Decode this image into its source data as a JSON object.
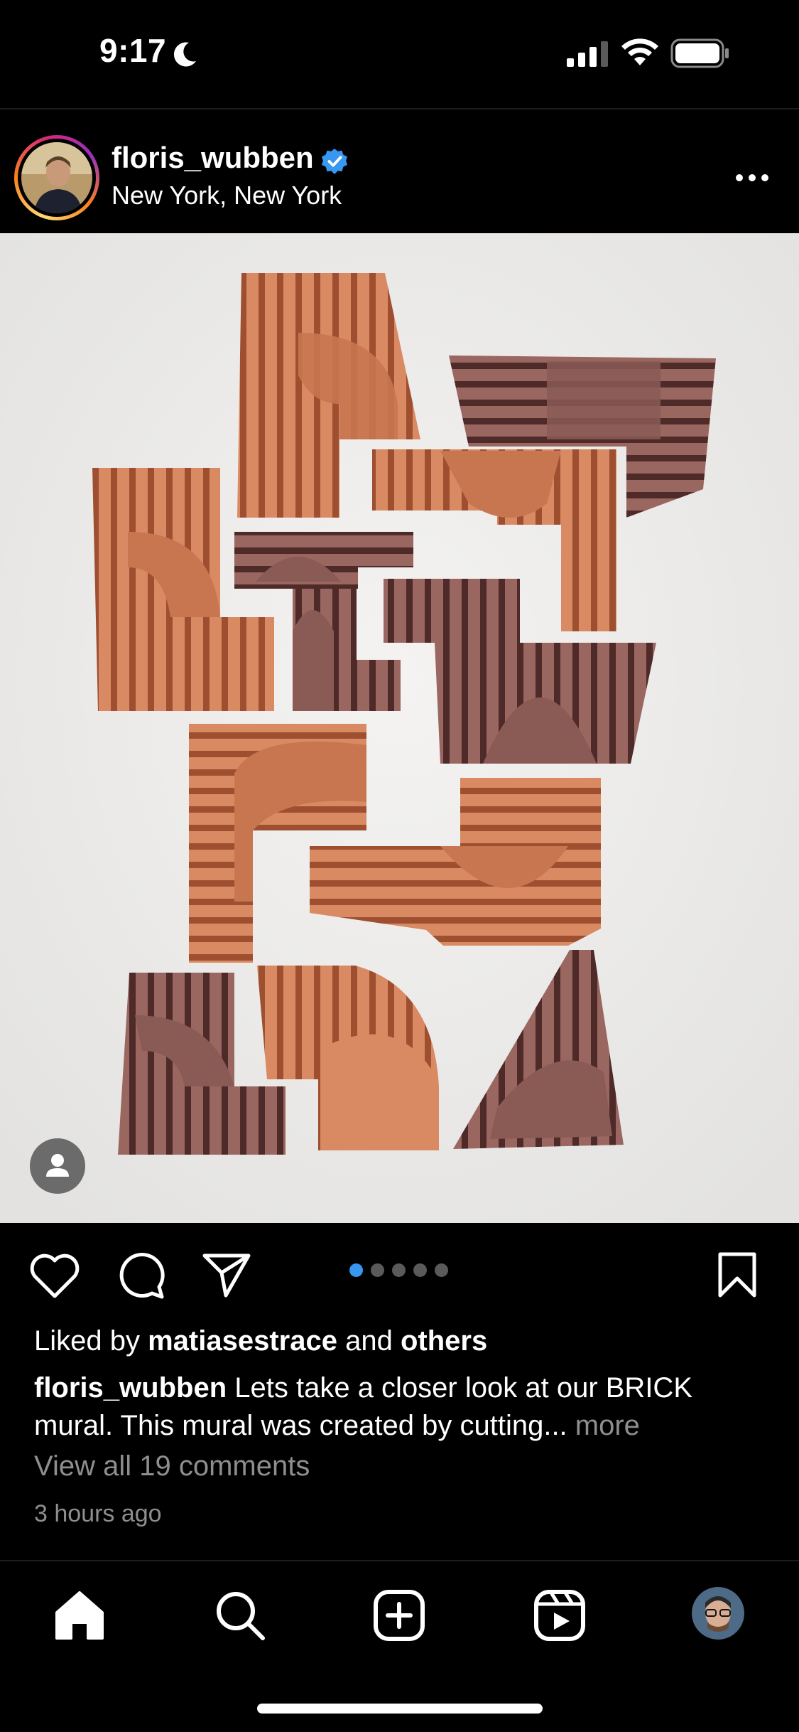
{
  "status_bar": {
    "time": "9:17",
    "icons": [
      "moon-icon",
      "cellular-signal-icon",
      "wifi-icon",
      "battery-icon"
    ]
  },
  "post": {
    "username": "floris_wubben",
    "verified": true,
    "location": "New York, New York",
    "image_alt": "terracotta brick mural",
    "carousel": {
      "total": 5,
      "active_index": 0
    },
    "liked_by": {
      "prefix": "Liked by ",
      "user": "matiasestrace",
      "middle": " and ",
      "others": "others"
    },
    "caption": {
      "user": "floris_wubben",
      "text": " Lets take a closer look at our BRICK mural. This mural was created by cutting...",
      "more": " more"
    },
    "view_comments": "View all 19 comments",
    "timestamp": "3 hours ago"
  },
  "tab_bar": {
    "items": [
      "home-icon",
      "search-icon",
      "create-icon",
      "reels-icon",
      "profile-avatar"
    ]
  },
  "colors": {
    "background": "#000000",
    "accent_blue": "#3897f0",
    "secondary_text": "#8e8e8e",
    "brick_orange": "#d9845b",
    "brick_purple": "#8a5a55"
  }
}
